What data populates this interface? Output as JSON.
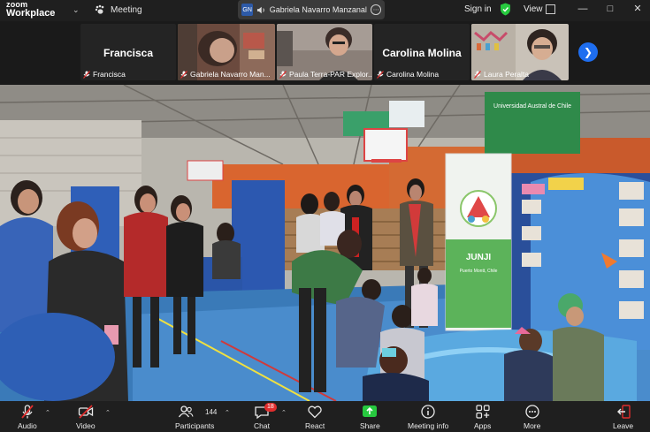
{
  "app": {
    "logo_line1": "zoom",
    "logo_line2": "Workplace",
    "meeting_label": "Meeting",
    "active_speaker_initials": "GN",
    "active_speaker": "Gabriela Navarro Manzanal's",
    "sign_in": "Sign in",
    "view": "View"
  },
  "gallery": {
    "tiles": [
      {
        "big_name": "Francisca",
        "label": "Francisca",
        "has_video": false,
        "active": false
      },
      {
        "big_name": "",
        "label": "Gabriela Navarro Man...",
        "has_video": true,
        "active": true
      },
      {
        "big_name": "",
        "label": "Paula Terra-PAR Explor...",
        "has_video": true,
        "active": false
      },
      {
        "big_name": "Carolina Molina",
        "label": "Carolina Molina",
        "has_video": false,
        "active": false
      },
      {
        "big_name": "",
        "label": "Laura Peralta",
        "has_video": true,
        "active": false
      }
    ]
  },
  "scene": {
    "banner_text": "Universidad Austral de Chile",
    "standee_title": "JUNJI",
    "standee_sub": "Puerto Montt, Chile"
  },
  "toolbar": {
    "audio": "Audio",
    "video": "Video",
    "participants": "Participants",
    "participants_count": "144",
    "chat": "Chat",
    "chat_badge": "18",
    "react": "React",
    "share": "Share",
    "meeting_info": "Meeting info",
    "apps": "Apps",
    "more": "More",
    "leave": "Leave"
  },
  "colors": {
    "accent_blue": "#1e6ef0",
    "active_green": "#2ecc71",
    "share_green": "#27c93f",
    "danger_red": "#e02d2d"
  }
}
